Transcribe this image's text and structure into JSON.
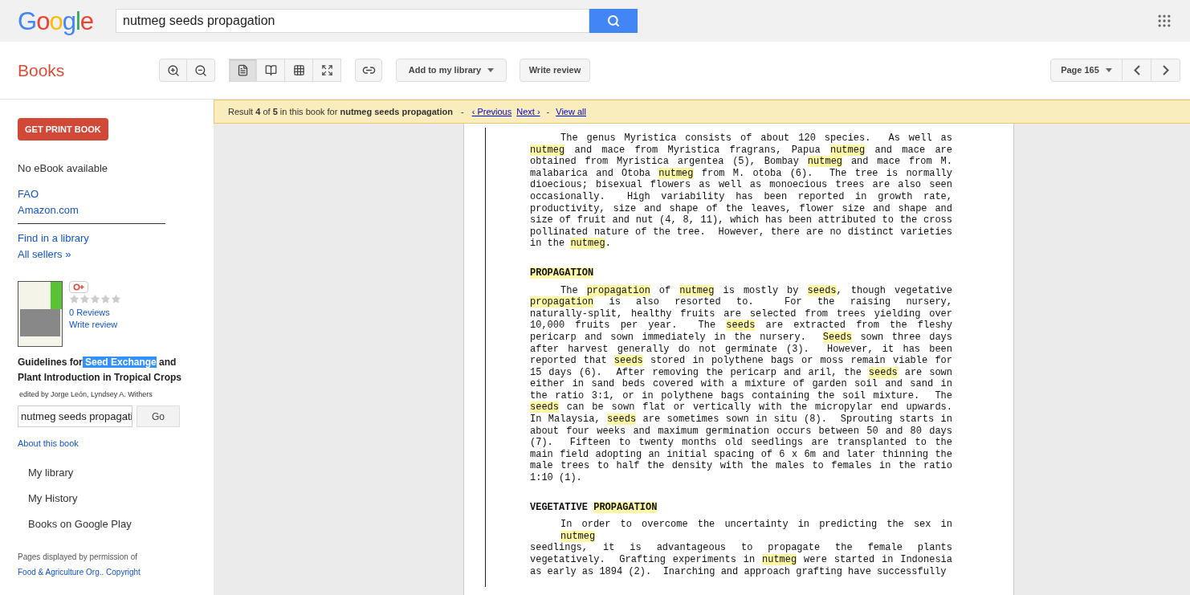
{
  "header": {
    "logo": "Google",
    "search": {
      "value": "nutmeg seeds propagation"
    }
  },
  "toolbar": {
    "section_title": "Books",
    "view_modes": [
      {
        "selected": true
      },
      {
        "selected": false
      },
      {
        "selected": false
      },
      {
        "selected": false
      }
    ],
    "add_to_library": "Add to my library",
    "write_review": "Write review",
    "page_select": "Page 165"
  },
  "sidebar": {
    "get_print_book": "GET PRINT BOOK",
    "ebook_status": "No eBook available",
    "sellers": [
      "FAO",
      "Amazon.com"
    ],
    "more_links": [
      "Find in a library",
      "All sellers »"
    ],
    "rating": {
      "stars": 0,
      "reviews": "0 Reviews",
      "write_review": "Write review"
    },
    "book_title": [
      {
        "text": "Guidelines for",
        "selected": false
      },
      {
        "text": " Seed Exchange",
        "selected": true
      },
      {
        "text": " and Plant Introduction in Tropical Crops",
        "selected": false
      }
    ],
    "authors": "edited by Jorge León, Lyndsey A. Withers",
    "search_in_book": {
      "value": "nutmeg seeds propagati",
      "button": "Go"
    },
    "about": "About this book",
    "nav": [
      "My library",
      "My History",
      "Books on Google Play"
    ],
    "permission": {
      "text": "Pages displayed by permission of ",
      "publisher": "Food & Agriculture Org.",
      "copyright": ". Copyright"
    }
  },
  "result_bar": {
    "summary": "Result **4** of **5** in this book for **nutmeg seeds propagation**",
    "separators": [
      "-",
      "-"
    ],
    "previous": "‹ Previous",
    "next": "Next ›",
    "view_all": "View all"
  },
  "page": [
    {
      "kind": "paragraph",
      "lines": [
        [
          {
            "text": "The genus Myristica consists of about 120 species.  As well as",
            "highlighted": false
          }
        ],
        [
          {
            "text": "nutmeg",
            "highlighted": true
          },
          {
            "text": " and mace from Myristica fragrans, Papua ",
            "highlighted": false
          },
          {
            "text": "nutmeg",
            "highlighted": true
          },
          {
            "text": " and mace are",
            "highlighted": false
          }
        ],
        [
          {
            "text": "obtained from Myristica argentea (5), Bombay ",
            "highlighted": false
          },
          {
            "text": "nutmeg",
            "highlighted": true
          },
          {
            "text": " and mace from M.",
            "highlighted": false
          }
        ],
        [
          {
            "text": "malabarica and Otoba ",
            "highlighted": false
          },
          {
            "text": "nutmeg",
            "highlighted": true
          },
          {
            "text": " from M. otoba (6).  The tree is normally",
            "highlighted": false
          }
        ],
        [
          {
            "text": "dioecious; bisexual flowers as well as monoecious trees are also seen",
            "highlighted": false
          }
        ],
        [
          {
            "text": "occasionally.  High variability has been reported in growth rate,",
            "highlighted": false
          }
        ],
        [
          {
            "text": "productivity, size and shape of the leaves, flower size and shape and",
            "highlighted": false
          }
        ],
        [
          {
            "text": "size of fruit and nut (4, 8, 11), which has been attributed to the cross",
            "highlighted": false
          }
        ],
        [
          {
            "text": "pollinated nature of the tree.  However, there are no distinct varieties",
            "highlighted": false
          }
        ],
        [
          {
            "text": "in the ",
            "highlighted": false
          },
          {
            "text": "nutmeg",
            "highlighted": true
          },
          {
            "text": ".",
            "highlighted": false
          }
        ]
      ]
    },
    {
      "kind": "heading",
      "lines": [
        [
          {
            "text": "PROPAGATION",
            "highlighted": true
          }
        ]
      ]
    },
    {
      "kind": "paragraph",
      "lines": [
        [
          {
            "text": "The ",
            "highlighted": false
          },
          {
            "text": "propagation",
            "highlighted": true
          },
          {
            "text": " of ",
            "highlighted": false
          },
          {
            "text": "nutmeg",
            "highlighted": true
          },
          {
            "text": " is mostly by ",
            "highlighted": false
          },
          {
            "text": "seeds",
            "highlighted": true
          },
          {
            "text": ", though vegetative",
            "highlighted": false
          }
        ],
        [
          {
            "text": "propagation",
            "highlighted": true
          },
          {
            "text": " is also resorted to.  For the raising nursery,",
            "highlighted": false
          }
        ],
        [
          {
            "text": "naturally-split, healthy fruits are selected from trees yielding over",
            "highlighted": false
          }
        ],
        [
          {
            "text": "10,000 fruits per year.  The ",
            "highlighted": false
          },
          {
            "text": "seeds",
            "highlighted": true
          },
          {
            "text": " are extracted from the fleshy",
            "highlighted": false
          }
        ],
        [
          {
            "text": "pericarp and sown immediately in the nursery.  ",
            "highlighted": false
          },
          {
            "text": "Seeds",
            "highlighted": true
          },
          {
            "text": " sown three days",
            "highlighted": false
          }
        ],
        [
          {
            "text": "after harvest generally do not germinate (3).  However, it has been",
            "highlighted": false
          }
        ],
        [
          {
            "text": "reported that ",
            "highlighted": false
          },
          {
            "text": "seeds",
            "highlighted": true
          },
          {
            "text": " stored in polythene bags or moss remain viable for",
            "highlighted": false
          }
        ],
        [
          {
            "text": "15 days (6).  After removing the pericarp and aril, the ",
            "highlighted": false
          },
          {
            "text": "seeds",
            "highlighted": true
          },
          {
            "text": " are sown",
            "highlighted": false
          }
        ],
        [
          {
            "text": "either in sand beds covered with a mixture of garden soil and sand in",
            "highlighted": false
          }
        ],
        [
          {
            "text": "the ratio 3:1, or in polythene bags containing the soil mixture.  The",
            "highlighted": false
          }
        ],
        [
          {
            "text": "seeds",
            "highlighted": true
          },
          {
            "text": " can be sown flat or vertically with the micropylar end upwards.",
            "highlighted": false
          }
        ],
        [
          {
            "text": "In Malaysia, ",
            "highlighted": false
          },
          {
            "text": "seeds",
            "highlighted": true
          },
          {
            "text": " are sometimes sown in situ (8).  Sprouting starts in",
            "highlighted": false
          }
        ],
        [
          {
            "text": "about four weeks and maximum germination occurs between 50 and 80 days",
            "highlighted": false
          }
        ],
        [
          {
            "text": "(7).  Fifteen to twenty months old seedlings are transplanted to the",
            "highlighted": false
          }
        ],
        [
          {
            "text": "main field adopting an initial spacing of 6 x 6m and later thinning the",
            "highlighted": false
          }
        ],
        [
          {
            "text": "male trees to half the density with the males to females in the ratio",
            "highlighted": false
          }
        ],
        [
          {
            "text": "1:10 (1).",
            "highlighted": false
          }
        ]
      ]
    },
    {
      "kind": "heading",
      "lines": [
        [
          {
            "text": "VEGETATIVE ",
            "highlighted": false
          },
          {
            "text": "PROPAGATION",
            "highlighted": true
          }
        ]
      ]
    },
    {
      "kind": "paragraph",
      "lines": [
        [
          {
            "text": "In order to overcome the uncertainty in predicting the sex in ",
            "highlighted": false
          },
          {
            "text": "nutmeg",
            "highlighted": true
          }
        ],
        [
          {
            "text": "seedlings, it is advantageous to propagate the female plants",
            "highlighted": false
          }
        ],
        [
          {
            "text": "vegetatively.  Grafting experiments in ",
            "highlighted": false
          },
          {
            "text": "nutmeg",
            "highlighted": true
          },
          {
            "text": " were started in Indonesia",
            "highlighted": false
          }
        ],
        [
          {
            "text": "as early as 1894 (2).  Inarching and approach grafting have successfully",
            "highlighted": false
          }
        ]
      ]
    }
  ]
}
